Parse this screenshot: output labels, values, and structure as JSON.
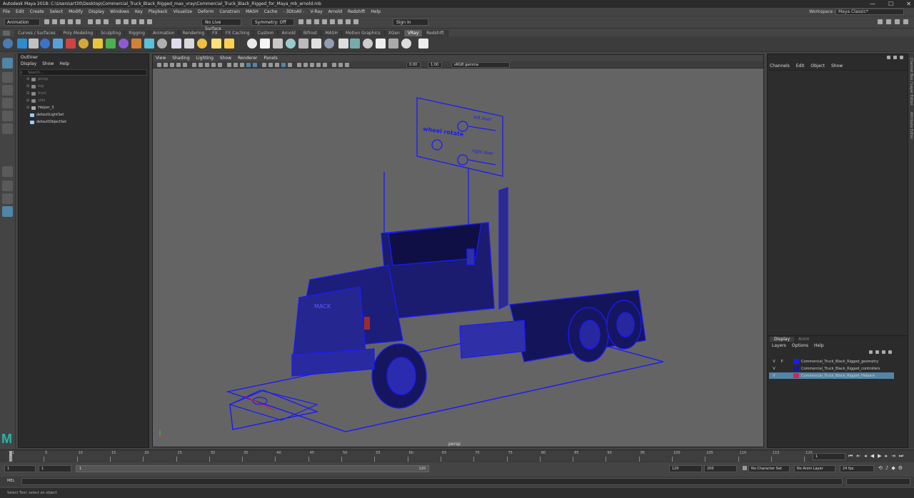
{
  "window": {
    "title": "Autodesk Maya 2018: C:\\Users\\art30\\Desktop\\Commercial_Truck_Black_Rigged_max_vray\\Commercial_Truck_Black_Rigged_for_Maya_mb_arnold.mb",
    "minimize": "—",
    "maximize": "☐",
    "close": "✕"
  },
  "menubar": [
    "File",
    "Edit",
    "Create",
    "Select",
    "Modify",
    "Display",
    "Windows",
    "Key",
    "Playback",
    "Visualize",
    "Deform",
    "Constrain",
    "MASH",
    "Cache",
    "- 3DtoAll -",
    "V-Ray",
    "Arnold",
    "Redshift",
    "Help"
  ],
  "workspace": {
    "label": "Workspace :",
    "value": "Maya Classic*"
  },
  "statusline": {
    "mode": "Animation",
    "live_surface": "No Live Surface",
    "symmetry": "Symmetry: Off",
    "sign_in": "Sign In"
  },
  "shelf_tabs": [
    "Curves / Surfaces",
    "Poly Modeling",
    "Sculpting",
    "Rigging",
    "Animation",
    "Rendering",
    "FX",
    "FX Caching",
    "Custom",
    "Arnold",
    "Bifrost",
    "MASH",
    "Motion Graphics",
    "XGen",
    "VRay",
    "Redshift"
  ],
  "shelf_active": "VRay",
  "outliner": {
    "title": "Outliner",
    "menu": [
      "Display",
      "Show",
      "Help"
    ],
    "search_placeholder": "Search...",
    "items": [
      {
        "label": "persp",
        "dim": true,
        "icon": "camera-icon"
      },
      {
        "label": "top",
        "dim": true,
        "icon": "camera-icon"
      },
      {
        "label": "front",
        "dim": true,
        "icon": "camera-icon"
      },
      {
        "label": "side",
        "dim": true,
        "icon": "camera-icon"
      },
      {
        "label": "Helper_3",
        "dim": false,
        "icon": "transform-icon"
      },
      {
        "label": "defaultLightSet",
        "dim": false,
        "icon": "set-icon"
      },
      {
        "label": "defaultObjectSet",
        "dim": false,
        "icon": "set-icon"
      }
    ]
  },
  "viewport": {
    "menu": [
      "View",
      "Shading",
      "Lighting",
      "Show",
      "Renderer",
      "Panels"
    ],
    "exposure": "0.00",
    "gamma": "1.00",
    "color_space": "sRGB gamma",
    "camera_label": "persp",
    "board": {
      "wheel_rotate": "wheel rotate",
      "left_door": "left door",
      "right_door": "right door"
    },
    "truck_label": "MACK"
  },
  "channel_box": {
    "menu": [
      "Channels",
      "Edit",
      "Object",
      "Show"
    ]
  },
  "layer_editor": {
    "tabs": [
      "Display",
      "Anim"
    ],
    "menu": [
      "Layers",
      "Options",
      "Help"
    ],
    "layers": [
      {
        "v": "V",
        "p": "P",
        "name": "Commercial_Truck_Black_Rigged_geometry",
        "color": "#1a1aff",
        "selected": false
      },
      {
        "v": "V",
        "p": "",
        "name": "Commercial_Truck_Black_Rigged_controllers",
        "color": "#1a1a8a",
        "selected": false
      },
      {
        "v": "V",
        "p": "",
        "name": "Commercial_Truck_Black_Rigged_Helpers",
        "color": "#c8285a",
        "selected": true
      }
    ]
  },
  "side_tabs": [
    "Channel Box / Layer Editor",
    "Attribute Editor"
  ],
  "timeline": {
    "ticks": [
      "1",
      "5",
      "10",
      "15",
      "20",
      "25",
      "30",
      "35",
      "40",
      "45",
      "50",
      "55",
      "60",
      "65",
      "70",
      "75",
      "80",
      "85",
      "90",
      "95",
      "100",
      "105",
      "110",
      "115",
      "120"
    ],
    "current_frame": "1"
  },
  "range": {
    "start": "1",
    "start_inner": "1",
    "slider_start": "1",
    "slider_end": "120",
    "end_inner": "120",
    "end": "200",
    "character_set": "No Character Set",
    "anim_layer": "No Anim Layer",
    "fps": "24 fps"
  },
  "command_line": {
    "label": "MEL"
  },
  "help_line": "Select Tool: select an object",
  "colors": {
    "accent": "#5285a6",
    "wire": "#1a1aff",
    "viewport_bg": "#646464"
  }
}
